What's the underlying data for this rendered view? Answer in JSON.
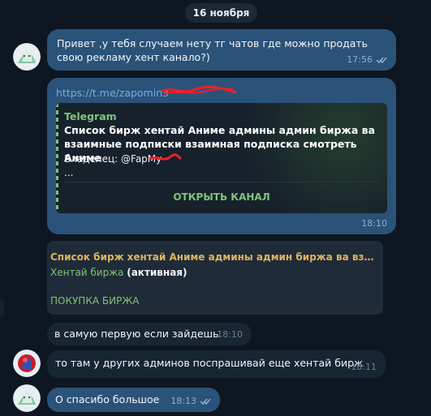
{
  "chat": {
    "date_pill": "16 ноября",
    "messages": [
      {
        "type": "outgoing",
        "text": "Привет ,у тебя случаем нету тг чатов где можно продать свою рекламу хент канало?)",
        "time": "17:56",
        "status": "read"
      },
      {
        "type": "outgoing",
        "link_text": "https://t.me/zapomin3",
        "preview_site": "Telegram",
        "preview_title": "Список бирж хентай Аниме админы админ биржа ва взаимные подписки взаимная подписка смотреть Аниме",
        "preview_owner": "Владелец: @FapMy",
        "preview_ellipsis": "...",
        "preview_button": "ОТКРЫТЬ КАНАЛ",
        "time": "18:10"
      },
      {
        "type": "incoming",
        "card_title": "Список бирж хентай Аниме админы админ биржа ва взаимные подписки взаимная подписка смотреть Аниме",
        "card_link": "Хентай биржа",
        "card_status": "(активная)",
        "card_button": "ПОКУПКА БИРЖА"
      },
      {
        "type": "incoming",
        "text": "в самую первую если зайдешь",
        "time": "18:10"
      },
      {
        "type": "incoming",
        "text": "то там у других админов поспрашивай еще хентай бирж",
        "time": "18:11"
      },
      {
        "type": "outgoing",
        "text": "О спасибо большое",
        "time": "18:13",
        "status": "read"
      }
    ]
  },
  "colors": {
    "background": "#0e1621",
    "outgoing_bubble": "#2b5278",
    "incoming_bubble": "#182533",
    "accent_green": "#7fc47a",
    "link_blue": "#6bb2ea"
  },
  "icons": {
    "avatar_1": "anime-avatar-icon",
    "avatar_2": "red-blue-avatar-icon",
    "check": "double-check-icon"
  }
}
